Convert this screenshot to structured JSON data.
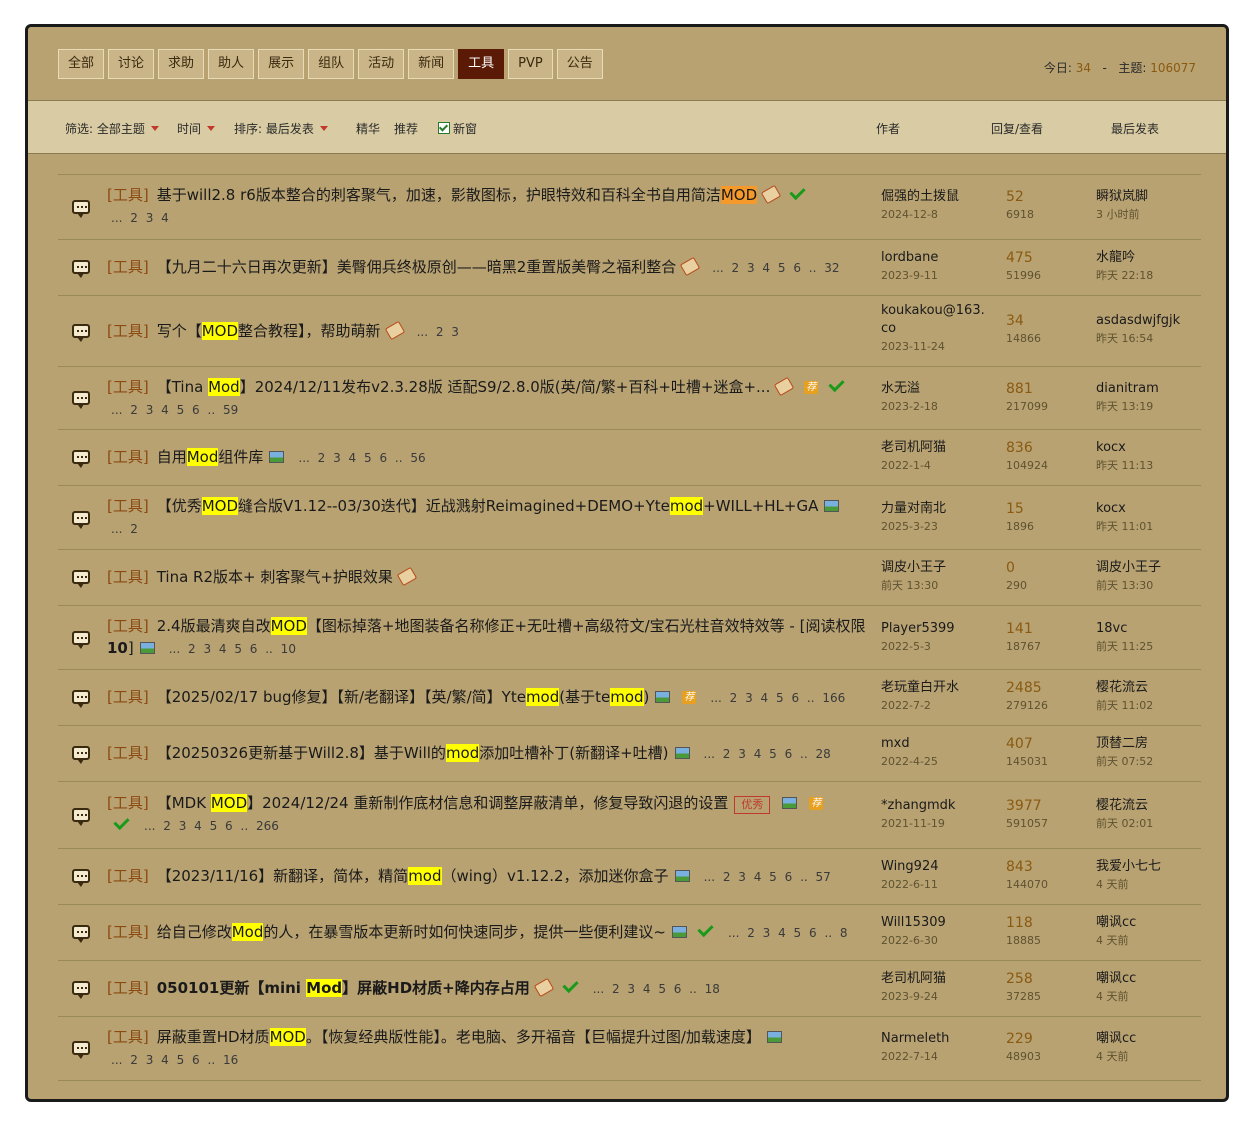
{
  "categories": [
    "全部",
    "讨论",
    "求助",
    "助人",
    "展示",
    "组队",
    "活动",
    "新闻",
    "工具",
    "PVP",
    "公告"
  ],
  "active_category": "工具",
  "stats": {
    "today_label": "今日:",
    "today": "34",
    "sep": "-",
    "topics_label": "主题:",
    "topics": "106077"
  },
  "filter_bar": {
    "filter": "筛选: 全部主题",
    "time": "时间",
    "sort": "排序: 最后发表",
    "digest": "精华",
    "recommend": "推荐",
    "new_window": "新窗",
    "col_author": "作者",
    "col_replies": "回复/查看",
    "col_last": "最后发表"
  },
  "threads": [
    {
      "tag": "[工具]",
      "author": "倔强的土拨鼠",
      "date": "2024-12-8",
      "replies": "52",
      "views": "6918",
      "last_user": "瞬狱岚脚",
      "last_time": "3 小时前"
    },
    {
      "tag": "[工具]",
      "author": "lordbane",
      "date": "2023-9-11",
      "replies": "475",
      "views": "51996",
      "last_user": "水龍吟",
      "last_time": "昨天 22:18"
    },
    {
      "tag": "[工具]",
      "author": "koukakou@163.co",
      "date": "2023-11-24",
      "replies": "34",
      "views": "14866",
      "last_user": "asdasdwjfgjk",
      "last_time": "昨天 16:54"
    },
    {
      "tag": "[工具]",
      "author": "水无溢",
      "date": "2023-2-18",
      "replies": "881",
      "views": "217099",
      "last_user": "dianitram",
      "last_time": "昨天 13:19"
    },
    {
      "tag": "[工具]",
      "author": "老司机阿猫",
      "date": "2022-1-4",
      "replies": "836",
      "views": "104924",
      "last_user": "kocx",
      "last_time": "昨天 11:13"
    },
    {
      "tag": "[工具]",
      "author": "力量对南北",
      "date": "2025-3-23",
      "replies": "15",
      "views": "1896",
      "last_user": "kocx",
      "last_time": "昨天 11:01"
    },
    {
      "tag": "[工具]",
      "author": "调皮小王子",
      "date": "前天 13:30",
      "replies": "0",
      "views": "290",
      "last_user": "调皮小王子",
      "last_time": "前天 13:30"
    },
    {
      "tag": "[工具]",
      "author": "Player5399",
      "date": "2022-5-3",
      "replies": "141",
      "views": "18767",
      "last_user": "18vc",
      "last_time": "前天 11:25"
    },
    {
      "tag": "[工具]",
      "author": "老玩童白开水",
      "date": "2022-7-2",
      "replies": "2485",
      "views": "279126",
      "last_user": "樱花流云",
      "last_time": "前天 11:02"
    },
    {
      "tag": "[工具]",
      "author": "mxd",
      "date": "2022-4-25",
      "replies": "407",
      "views": "145031",
      "last_user": "顶替二房",
      "last_time": "前天 07:52"
    },
    {
      "tag": "[工具]",
      "author": "*zhangmdk",
      "date": "2021-11-19",
      "replies": "3977",
      "views": "591057",
      "last_user": "樱花流云",
      "last_time": "前天 02:01"
    },
    {
      "tag": "[工具]",
      "author": "Wing924",
      "date": "2022-6-11",
      "replies": "843",
      "views": "144070",
      "last_user": "我爱小七七",
      "last_time": "4 天前"
    },
    {
      "tag": "[工具]",
      "author": "Will15309",
      "date": "2022-6-30",
      "replies": "118",
      "views": "18885",
      "last_user": "嘲讽cc",
      "last_time": "4 天前"
    },
    {
      "tag": "[工具]",
      "author": "老司机阿猫",
      "date": "2023-9-24",
      "replies": "258",
      "views": "37285",
      "last_user": "嘲讽cc",
      "last_time": "4 天前"
    },
    {
      "tag": "[工具]",
      "author": "Narmeleth",
      "date": "2022-7-14",
      "replies": "229",
      "views": "48903",
      "last_user": "嘲讽cc",
      "last_time": "4 天前"
    }
  ],
  "t0": {
    "a": "基于will2.8 r6版本整合的刺客聚气，加速，影散图标，护眼特效和百科全书自用简洁",
    "b": "MOD",
    "pages": "... 2 3 4"
  },
  "t1": {
    "a": "【九月二十六日再次更新】美臀佣兵终极原创——暗黑2重置版美臀之福利整合",
    "pages": "... 2 3 4 5 6 .. 32"
  },
  "t2": {
    "a": "写个【",
    "b": "MOD",
    "c": "整合教程】，帮助萌新",
    "pages": "... 2 3"
  },
  "t3": {
    "a": "【Tina ",
    "b": "Mod",
    "c": "】2024/12/11发布v2.3.28版 适配S9/2.8.0版(英/简/繁+百科+吐槽+迷盒+...",
    "pages": "... 2 3 4 5 6 .. 59",
    "hot": "荐"
  },
  "t4": {
    "a": "自用",
    "b": "Mod",
    "c": "组件库",
    "pages": "... 2 3 4 5 6 .. 56"
  },
  "t5": {
    "a": "【优秀",
    "b": "MOD",
    "c": "缝合版V1.12--03/30迭代】近战溅射Reimagined+DEMO+Yte",
    "d": "mod",
    "e": "+WILL+HL+GA",
    "pages": "... 2"
  },
  "t6": {
    "a": "Tina R2版本+ 刺客聚气+护眼效果"
  },
  "t7": {
    "a": "2.4版最清爽自改",
    "b": "MOD",
    "c": "【图标掉落+地图装备名称修正+无吐槽+高级符文/宝石光柱音效特效等 - [阅读权限 ",
    "d": "10",
    "e": "]",
    "pages": "... 2 3 4 5 6 .. 10"
  },
  "t8": {
    "a": "【2025/02/17 bug修复】【新/老翻译】【英/繁/简】Yte",
    "b": "mod",
    "c": "(基于te",
    "d": "mod",
    "e": ")",
    "pages": "... 2 3 4 5 6 .. 166",
    "hot": "荐"
  },
  "t9": {
    "a": "【20250326更新基于Will2.8】基于Will的",
    "b": "mod",
    "c": "添加吐槽补丁(新翻译+吐槽)",
    "pages": "... 2 3 4 5 6 .. 28"
  },
  "t10": {
    "a": "【MDK ",
    "b": "MOD",
    "c": "】2024/12/24 重新制作底材信息和调整屏蔽清单，修复导致闪退的设置",
    "badge": "优秀",
    "pages": "... 2 3 4 5 6 .. 266",
    "hot": "荐"
  },
  "t11": {
    "a": "【2023/11/16】新翻译，简体，精简",
    "b": "mod",
    "c": "（wing）v1.12.2，添加迷你盒子",
    "pages": "... 2 3 4 5 6 .. 57"
  },
  "t12": {
    "a": "给自己修改",
    "b": "Mod",
    "c": "的人，在暴雪版本更新时如何快速同步，提供一些便利建议~",
    "pages": "... 2 3 4 5 6 .. 8"
  },
  "t13": {
    "a": "050101更新【mini ",
    "b": "Mod",
    "c": "】屏蔽HD材质+降内存占用",
    "pages": "... 2 3 4 5 6 .. 18"
  },
  "t14": {
    "a": "屏蔽重置HD材质",
    "b": "MOD",
    "c": "。【恢复经典版性能】。老电脑、多开福音【巨幅提升过图/加载速度】",
    "pages": "... 2 3 4 5 6 .. 16"
  }
}
